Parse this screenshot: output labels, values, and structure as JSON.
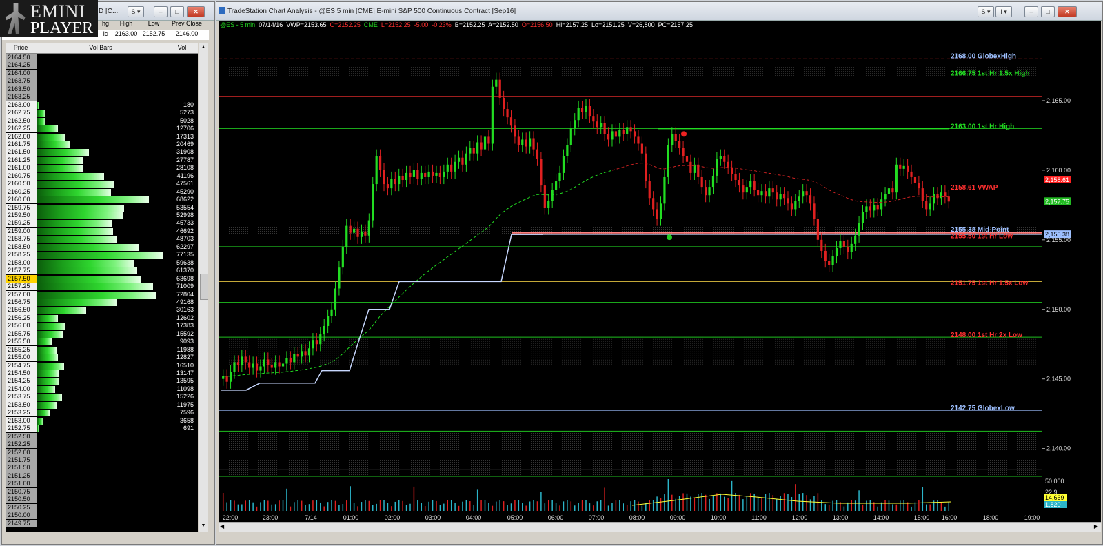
{
  "logo": {
    "line1": "EMINI",
    "line2": "PLAYER"
  },
  "left_window": {
    "title": "D [C...",
    "quote_headers": [
      "hg",
      "High",
      "Low",
      "Prev Close"
    ],
    "quote_values": [
      "2163.00",
      "2152.75",
      "2146.00"
    ],
    "quote_partial": "ic",
    "columns": [
      "Price",
      "Vol Bars",
      "Vol"
    ],
    "rows": [
      {
        "price": "2164.50",
        "vol": ""
      },
      {
        "price": "2164.25",
        "vol": ""
      },
      {
        "price": "2164.00",
        "vol": ""
      },
      {
        "price": "2163.75",
        "vol": ""
      },
      {
        "price": "2163.50",
        "vol": ""
      },
      {
        "price": "2163.25",
        "vol": ""
      },
      {
        "price": "2163.00",
        "vol": "180"
      },
      {
        "price": "2162.75",
        "vol": "5273"
      },
      {
        "price": "2162.50",
        "vol": "5028"
      },
      {
        "price": "2162.25",
        "vol": "12706"
      },
      {
        "price": "2162.00",
        "vol": "17313"
      },
      {
        "price": "2161.75",
        "vol": "20469"
      },
      {
        "price": "2161.50",
        "vol": "31908"
      },
      {
        "price": "2161.25",
        "vol": "27787"
      },
      {
        "price": "2161.00",
        "vol": "28108"
      },
      {
        "price": "2160.75",
        "vol": "41196"
      },
      {
        "price": "2160.50",
        "vol": "47561"
      },
      {
        "price": "2160.25",
        "vol": "45290"
      },
      {
        "price": "2160.00",
        "vol": "68622"
      },
      {
        "price": "2159.75",
        "vol": "53554"
      },
      {
        "price": "2159.50",
        "vol": "52998"
      },
      {
        "price": "2159.25",
        "vol": "45733"
      },
      {
        "price": "2159.00",
        "vol": "46692"
      },
      {
        "price": "2158.75",
        "vol": "48703"
      },
      {
        "price": "2158.50",
        "vol": "62297"
      },
      {
        "price": "2158.25",
        "vol": "77135"
      },
      {
        "price": "2158.00",
        "vol": "59638"
      },
      {
        "price": "2157.75",
        "vol": "61370"
      },
      {
        "price": "2157.50",
        "vol": "63698"
      },
      {
        "price": "2157.25",
        "vol": "71009"
      },
      {
        "price": "2157.00",
        "vol": "72804"
      },
      {
        "price": "2156.75",
        "vol": "49168"
      },
      {
        "price": "2156.50",
        "vol": "30163"
      },
      {
        "price": "2156.25",
        "vol": "12602"
      },
      {
        "price": "2156.00",
        "vol": "17383"
      },
      {
        "price": "2155.75",
        "vol": "15592"
      },
      {
        "price": "2155.50",
        "vol": "9093"
      },
      {
        "price": "2155.25",
        "vol": "11988"
      },
      {
        "price": "2155.00",
        "vol": "12827"
      },
      {
        "price": "2154.75",
        "vol": "16510"
      },
      {
        "price": "2154.50",
        "vol": "13147"
      },
      {
        "price": "2154.25",
        "vol": "13595"
      },
      {
        "price": "2154.00",
        "vol": "11098"
      },
      {
        "price": "2153.75",
        "vol": "15226"
      },
      {
        "price": "2153.50",
        "vol": "11975"
      },
      {
        "price": "2153.25",
        "vol": "7596"
      },
      {
        "price": "2153.00",
        "vol": "3658"
      },
      {
        "price": "2152.75",
        "vol": "691"
      },
      {
        "price": "2152.50",
        "vol": ""
      },
      {
        "price": "2152.25",
        "vol": ""
      },
      {
        "price": "2152.00",
        "vol": ""
      },
      {
        "price": "2151.75",
        "vol": ""
      },
      {
        "price": "2151.50",
        "vol": ""
      },
      {
        "price": "2151.25",
        "vol": ""
      },
      {
        "price": "2151.00",
        "vol": ""
      },
      {
        "price": "2150.75",
        "vol": ""
      },
      {
        "price": "2150.50",
        "vol": ""
      },
      {
        "price": "2150.25",
        "vol": ""
      },
      {
        "price": "2150.00",
        "vol": ""
      },
      {
        "price": "2149.75",
        "vol": ""
      }
    ],
    "highlight_price": "2157.50"
  },
  "right_window": {
    "title": "TradeStation Chart Analysis - @ES 5 min [CME] E-mini S&P 500 Continuous Contract [Sep16]",
    "status": {
      "symbol": "@ES - 5 min",
      "date": "07/14/16",
      "vwp": "VWP=2153.65",
      "close": "C=2152.25",
      "exch": "CME",
      "last": "L=2152.25",
      "chg": "-5.00",
      "pct": "-0.23%",
      "bid": "B=2152.25",
      "ask": "A=2152.50",
      "open": "O=2156.50",
      "hi": "Hi=2157.25",
      "lo": "Lo=2151.25",
      "vol": "V=26,800",
      "pc": "PC=2157.25"
    }
  },
  "chart_data": {
    "type": "candlestick",
    "ylim": [
      2138,
      2170
    ],
    "yticks": [
      "2,165.00",
      "2,160.00",
      "2,155.00",
      "2,150.00",
      "2,145.00",
      "2,140.00"
    ],
    "xticks": [
      "22:00",
      "23:00",
      "7/14",
      "01:00",
      "02:00",
      "03:00",
      "04:00",
      "05:00",
      "06:00",
      "07:00",
      "08:00",
      "09:00",
      "10:00",
      "11:00",
      "12:00",
      "13:00",
      "14:00",
      "15:00",
      "16:00",
      "18:00",
      "19:00"
    ],
    "levels": [
      {
        "label": "2168.00 GlobexHigh",
        "color": "#9ec0ff"
      },
      {
        "label": "2166.75 1st Hr 1.5x High",
        "color": "#22dd22"
      },
      {
        "label": "2163.00 1st Hr  High",
        "color": "#22dd22"
      },
      {
        "label": "2158.61 VWAP",
        "color": "#ff3030"
      },
      {
        "label": "2155.38 Mid-Point",
        "color": "#9ec0ff"
      },
      {
        "label": "2155.50 1st Hr  Low",
        "color": "#ff3030"
      },
      {
        "label": "2151.75 1st Hr  1.5x Low",
        "color": "#ff3030"
      },
      {
        "label": "2148.00 1st Hr  2x Low",
        "color": "#ff3030"
      },
      {
        "label": "2142.75 GlobexLow",
        "color": "#9ec0ff"
      }
    ],
    "price_tags": [
      {
        "text": "2,158.61",
        "color": "#ff2020"
      },
      {
        "text": "2,157.75",
        "color": "#22bb22"
      },
      {
        "text": "2,155.38",
        "color": "#9ec0ff"
      }
    ],
    "volume_axis": [
      "50,000",
      "14,669",
      "1,820"
    ],
    "volume_partial_tag": "22,9"
  }
}
